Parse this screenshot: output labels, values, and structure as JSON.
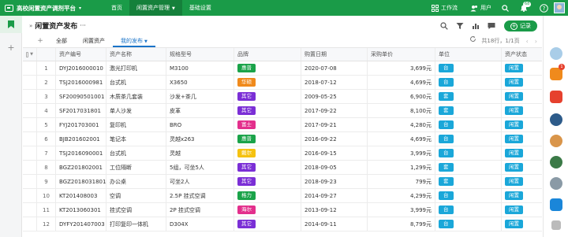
{
  "topbar": {
    "app_title": "高校闲置资产调剂平台",
    "nav": [
      {
        "label": "首页",
        "active": false
      },
      {
        "label": "闲置资产管理",
        "active": true
      },
      {
        "label": "基础设置",
        "active": false
      }
    ],
    "workbench_label": "工作流",
    "user_label": "用户",
    "notification_count": "68"
  },
  "page": {
    "title": "闲置资产发布",
    "title_more": "···",
    "add_button_label": "记录",
    "tabs": [
      {
        "label": "全部",
        "active": false
      },
      {
        "label": "闲置资产",
        "active": false
      },
      {
        "label": "我的发布",
        "active": true
      }
    ],
    "pager_text": "共18行，1/1页"
  },
  "rightrail": {
    "badge": "1"
  },
  "colors": {
    "primary_green": "#1a9b48",
    "tab_blue": "#1a73c8",
    "cyan_tag": "#1aa7d9"
  },
  "table": {
    "headers": {
      "code": "资产编号",
      "name": "资产名称",
      "spec": "规格型号",
      "brand": "品牌",
      "date": "购置日期",
      "price": "采购单价",
      "unit": "单位",
      "status": "资产状态"
    },
    "rows": [
      {
        "idx": "1",
        "code": "DYJ2016000010",
        "name": "激光打印机",
        "spec": "M3100",
        "brand": "惠普",
        "brand_color": "#1aa349",
        "date": "2020-07-08",
        "price": "3,699元",
        "unit": "台",
        "status": "闲置"
      },
      {
        "idx": "2",
        "code": "TSJ2016000981",
        "name": "台式机",
        "spec": "X3650",
        "brand": "华硕",
        "brand_color": "#f08a1c",
        "date": "2018-07-12",
        "price": "4,699元",
        "unit": "台",
        "status": "闲置"
      },
      {
        "idx": "3",
        "code": "SF20090501001",
        "name": "木质茶几套装",
        "spec": "沙发+茶几",
        "brand": "其它",
        "brand_color": "#7b2fd6",
        "date": "2009-05-25",
        "price": "6,900元",
        "unit": "套",
        "status": "闲置"
      },
      {
        "idx": "4",
        "code": "SF2017031801",
        "name": "单人沙发",
        "spec": "皮革",
        "brand": "其它",
        "brand_color": "#7b2fd6",
        "date": "2017-09-22",
        "price": "8,100元",
        "unit": "套",
        "status": "闲置"
      },
      {
        "idx": "5",
        "code": "FYJ201703001",
        "name": "复印机",
        "spec": "BRO",
        "brand": "富士",
        "brand_color": "#e32f8c",
        "date": "2017-09-21",
        "price": "4,280元",
        "unit": "台",
        "status": "闲置"
      },
      {
        "idx": "6",
        "code": "BJB201602001",
        "name": "笔记本",
        "spec": "灵越x263",
        "brand": "惠普",
        "brand_color": "#1aa349",
        "date": "2016-09-22",
        "price": "4,699元",
        "unit": "台",
        "status": "闲置"
      },
      {
        "idx": "7",
        "code": "TSJ2016090001",
        "name": "台式机",
        "spec": "灵越",
        "brand": "戴尔",
        "brand_color": "#f5c211",
        "date": "2016-09-15",
        "price": "3,999元",
        "unit": "台",
        "status": "闲置"
      },
      {
        "idx": "8",
        "code": "BGZ201802001",
        "name": "工位隔断",
        "spec": "5组，可坐5人",
        "brand": "其它",
        "brand_color": "#7b2fd6",
        "date": "2018-09-05",
        "price": "1,299元",
        "unit": "套",
        "status": "闲置"
      },
      {
        "idx": "9",
        "code": "BGZ2018031801",
        "name": "办公桌",
        "spec": "可坐2人",
        "brand": "其它",
        "brand_color": "#7b2fd6",
        "date": "2018-09-23",
        "price": "799元",
        "unit": "套",
        "status": "闲置"
      },
      {
        "idx": "10",
        "code": "KT201408003",
        "name": "空调",
        "spec": "2.5P 挂式空调",
        "brand": "格力",
        "brand_color": "#1aa349",
        "date": "2014-09-27",
        "price": "4,299元",
        "unit": "台",
        "status": "闲置"
      },
      {
        "idx": "11",
        "code": "KT2013060301",
        "name": "挂式空调",
        "spec": "2P 挂式空调",
        "brand": "海尔",
        "brand_color": "#e32f8c",
        "date": "2013-09-12",
        "price": "3,999元",
        "unit": "台",
        "status": "闲置"
      },
      {
        "idx": "12",
        "code": "DYFY201407003",
        "name": "打印复印一体机",
        "spec": "D304X",
        "brand": "其它",
        "brand_color": "#7b2fd6",
        "date": "2014-09-11",
        "price": "8,799元",
        "unit": "台",
        "status": "闲置"
      }
    ]
  }
}
